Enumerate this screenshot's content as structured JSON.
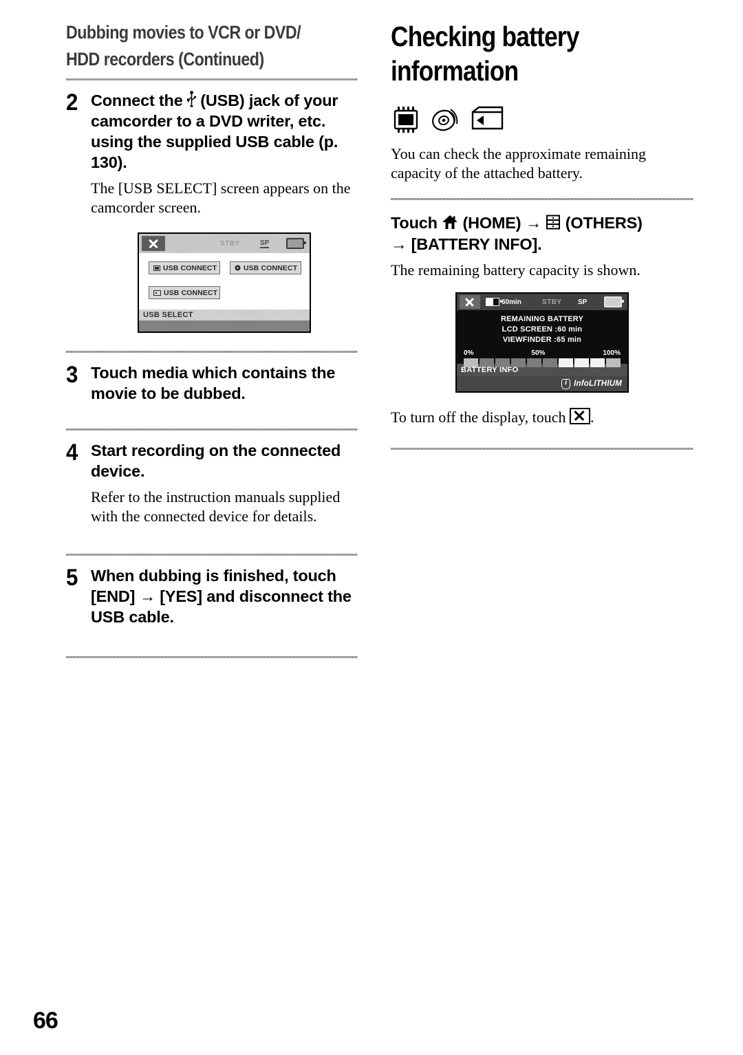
{
  "page_number": "66",
  "left_column": {
    "running_head_lines": [
      "Dubbing movies to VCR or DVD/",
      "HDD recorders (Continued)"
    ],
    "steps": [
      {
        "number": "2",
        "heading_before_icon": "Connect the",
        "icon": "usb-icon",
        "heading_after_icon": "(USB) jack of your camcorder to a DVD writer, etc. using the supplied USB cable (p. 130).",
        "note": "The [USB SELECT] screen appears on the camcorder screen."
      },
      {
        "number": "3",
        "heading": "Touch media which contains the movie to be dubbed.",
        "note": ""
      },
      {
        "number": "4",
        "heading": "Start recording on the connected device.",
        "note": "Refer to the instruction manuals supplied with the connected device for details."
      },
      {
        "number": "5",
        "heading": "When dubbing is finished, touch [END] → [YES] and disconnect the USB cable.",
        "note": ""
      }
    ],
    "usb_select_screen": {
      "close_button": "close-x-button",
      "status_stby": "STBY",
      "status_mode": "SP",
      "buttons": [
        {
          "icon": "hdd-icon",
          "label": "USB CONNECT"
        },
        {
          "icon": "disc-icon",
          "label": "USB CONNECT"
        },
        {
          "icon": "memory-card-icon",
          "label": "USB CONNECT"
        }
      ],
      "footer_label": "USB SELECT"
    }
  },
  "right_column": {
    "title_lines": [
      "Checking battery",
      "information"
    ],
    "media_icons": [
      "hdd-icon",
      "disc-icon",
      "memory-card-icon"
    ],
    "intro": "You can check the approximate remaining capacity of the attached battery.",
    "touch_path": {
      "prefix": "Touch",
      "home_icon": "home-icon",
      "home_label": "(HOME)",
      "arrow": "→",
      "others_icon": "others-icon",
      "others_label": "(OTHERS)",
      "arrow2": "→",
      "final_label": "[BATTERY INFO]."
    },
    "after_touch": "The remaining battery capacity is shown.",
    "battery_screen": {
      "close_button": "close-x-button",
      "battery_time": "60min",
      "status_stby": "STBY",
      "status_mode": "SP",
      "title": "REMAINING BATTERY",
      "lcd_line": "LCD SCREEN :60 min",
      "viewfinder_line": "VIEWFINDER :65 min",
      "gauge_labels": [
        "0%",
        "50%",
        "100%"
      ],
      "footer_label": "BATTERY INFO",
      "brand": "InfoLITHIUM",
      "brand_icon": "info-badge-icon"
    },
    "caption_prefix": "To turn off the display, touch",
    "caption_icon": "close-x-icon",
    "caption_suffix": "."
  }
}
